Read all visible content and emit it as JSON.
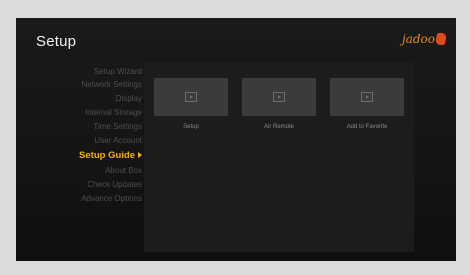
{
  "header": {
    "title": "Setup",
    "logo_text": "jadoo"
  },
  "sidebar": {
    "items": [
      {
        "label": "Setup Wizard",
        "active": false
      },
      {
        "label": "Network Settings",
        "active": false
      },
      {
        "label": "Display",
        "active": false
      },
      {
        "label": "Internal Storage",
        "active": false
      },
      {
        "label": "Time Settings",
        "active": false
      },
      {
        "label": "User Account",
        "active": false
      },
      {
        "label": "Setup Guide",
        "active": true
      },
      {
        "label": "About Box",
        "active": false
      },
      {
        "label": "Check Updates",
        "active": false
      },
      {
        "label": "Advance Options",
        "active": false
      }
    ]
  },
  "content": {
    "tiles": [
      {
        "label": "Setup",
        "icon": "play-icon"
      },
      {
        "label": "Air Remote",
        "icon": "play-icon"
      },
      {
        "label": "Add to Favorite",
        "icon": "play-icon"
      }
    ]
  },
  "colors": {
    "accent": "#f0b400",
    "background": "#141414",
    "tile": "#3b3b3b",
    "logo": "#e48a1e"
  }
}
